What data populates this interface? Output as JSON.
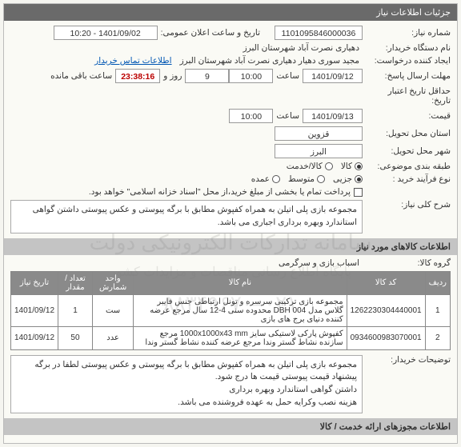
{
  "header_title": "جزئیات اطلاعات نیاز",
  "labels": {
    "need_no": "شماره نیاز:",
    "device_name": "نام دستگاه خریدار:",
    "requester": "ایجاد کننده درخواست:",
    "reply_deadline": "مهلت ارسال پاسخ:",
    "deadline_start": "حداقل تاریخ اعتبار",
    "history": "تاریخ:",
    "price": "قیمت:",
    "province": "استان محل تحویل:",
    "city": "شهر محل تحویل:",
    "group_topic": "طبقه بندی موضوعی:",
    "buy_process": "نوع فرآیند خرید :",
    "general_desc": "شرح کلی نیاز:",
    "goods_group": "گروه کالا:",
    "buyer_notes": "توضیحات خریدار:",
    "announce_date": "تاریخ و ساعت اعلان عمومی:",
    "hour": "ساعت",
    "day_and": "روز و",
    "remain": "ساعت باقی مانده",
    "contact_link": "اطلاعات تماس خریدار",
    "pay_note": "پرداخت تمام یا بخشی از مبلغ خرید،از محل \"اسناد خزانه اسلامی\" خواهد بود."
  },
  "values": {
    "need_no": "1101095846000036",
    "device_name": "دهیاری نصرت آباد شهرستان البرز",
    "requester": "مجید سوری دهیار دهیاری نصرت آباد شهرستان البرز",
    "reply_date": "1401/09/12",
    "reply_time": "10:00",
    "days": "9",
    "remain_time": "23:38:16",
    "deadline_date": "1401/09/13",
    "deadline_time": "10:00",
    "province": "قزوین",
    "city": "البرز",
    "announce": "1401/09/02 - 10:20",
    "general_desc": "مجموعه بازی پلی اتیلن به همراه کفپوش مطابق با برگه پیوستی و عکس پیوستی داشتن گواهی استاندارد وبهره برداری اجباری می باشد.",
    "goods_group": "اسباب بازی و سرگرمی",
    "buyer_notes": "مجموعه بازی پلی اتیلن به همراه کفپوش مطابق با برگه پیوستی و عکس پیوستی لطفا در برگه پیشنهاد قیمت پیوستی قیمت ها درج شود.\nداشتن گواهی استاندارد وبهره برداری\nهزینه نصب وکرایه حمل به عهده فروشنده می باشد."
  },
  "group_options": [
    "کالا",
    "کالا/خدمت"
  ],
  "group_selected": 0,
  "buy_options": [
    "جزیی",
    "متوسط",
    "عمده"
  ],
  "buy_selected": 0,
  "pay_checked": false,
  "section_items": "اطلاعات کالاهای مورد نیاز",
  "section_permits": "اطلاعات مجوزهای ارائه خدمت / کالا",
  "table": {
    "headers": [
      "ردیف",
      "کد کالا",
      "نام کالا",
      "واحد شمارش",
      "تعداد / مقدار",
      "تاریخ نیاز"
    ],
    "rows": [
      {
        "n": "1",
        "code": "1262230304440001",
        "name": "مجموعه بازی ترکیبی سرسره و تونل ارتباطی جنس فایبر گلاس مدل DBH 004 محدوده سنی 4-12 سال مرجع عرضه کننده دنیای برج های بازی",
        "unit": "ست",
        "qty": "1",
        "date": "1401/09/12"
      },
      {
        "n": "2",
        "code": "0934600983070001",
        "name": "کفپوش پارکی لاستیکی سایز 1000x1000x43 mm مرجع سازنده نشاط گستر وندا مرجع عرضه کننده نشاط گستر وندا",
        "unit": "عدد",
        "qty": "50",
        "date": "1401/09/12"
      }
    ]
  },
  "watermark": {
    "l1": "سامانه تدارکات الکترونیکی دولت",
    "l2": "پایگاه اطلاع رسانی مناقصات و مزایدات کشور",
    "l3": "۰۲۱–۸۸۳۴۹۶۷۰"
  }
}
